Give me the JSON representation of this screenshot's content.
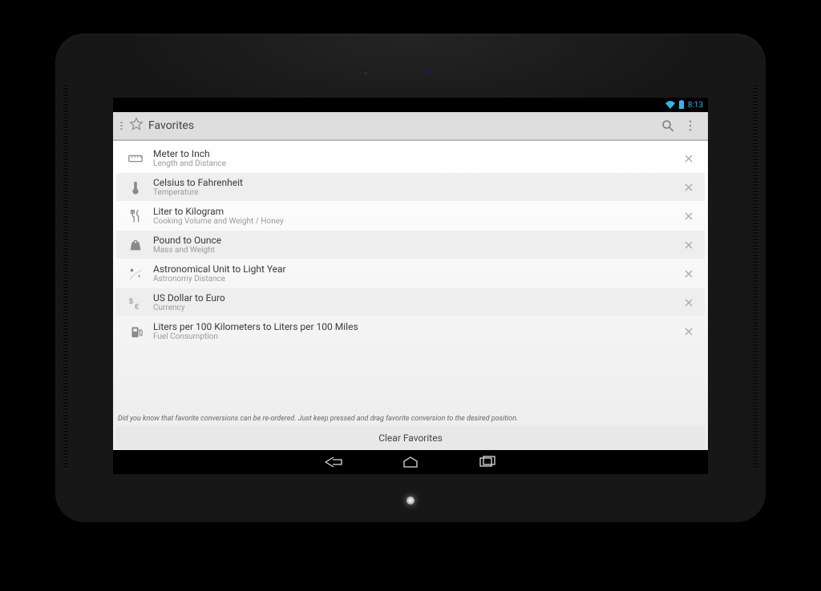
{
  "statusbar": {
    "time": "8:13"
  },
  "actionbar": {
    "title": "Favorites"
  },
  "favorites": [
    {
      "icon": "ruler",
      "title": "Meter to Inch",
      "subtitle": "Length and Distance"
    },
    {
      "icon": "thermo",
      "title": "Celsius to Fahrenheit",
      "subtitle": "Temperature"
    },
    {
      "icon": "cutlery",
      "title": "Liter to Kilogram",
      "subtitle": "Cooking Volume and Weight / Honey"
    },
    {
      "icon": "weight",
      "title": "Pound to Ounce",
      "subtitle": "Mass and Weight"
    },
    {
      "icon": "astronomy",
      "title": "Astronomical Unit to Light Year",
      "subtitle": "Astronomy Distance"
    },
    {
      "icon": "currency",
      "title": "US Dollar to Euro",
      "subtitle": "Currency"
    },
    {
      "icon": "fuel",
      "title": "Liters per 100 Kilometers to Liters per 100 Miles",
      "subtitle": "Fuel Consumption"
    }
  ],
  "hint": "Did you know that favorite conversions can be re-ordered. Just keep pressed and drag favorite conversion to the desired position.",
  "clear_label": "Clear Favorites"
}
